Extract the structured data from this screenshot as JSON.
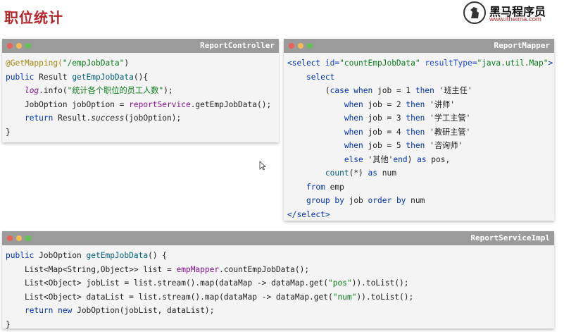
{
  "slide": {
    "title": "职位统计"
  },
  "brand": {
    "name": "黑马程序员",
    "url": "www.itheima.com"
  },
  "controller": {
    "title": "ReportController",
    "lines": [
      [
        "@GetMapping(",
        "\"/empJobData\"",
        ")"
      ],
      [
        "public",
        " Result ",
        "getEmpJobData",
        "(){"
      ],
      [
        "    ",
        "log",
        ".info(",
        "\"统计各个职位的员工人数\"",
        ");"
      ],
      [
        "    JobOption jobOption = ",
        "reportService",
        ".getEmpJobData();"
      ],
      [
        "    ",
        "return",
        " Result.",
        "success",
        "(jobOption);"
      ],
      [
        "}"
      ]
    ]
  },
  "mapper": {
    "title": "ReportMapper",
    "lines": [
      [
        "<select ",
        "id=",
        "\"countEmpJobData\"",
        " resultType=",
        "\"java.util.Map\"",
        ">"
      ],
      [
        "    ",
        "select"
      ],
      [
        "        (",
        "case when",
        " job = 1 ",
        "then",
        " '班主任'"
      ],
      [
        "            ",
        "when",
        " job = 2 ",
        "then",
        " '讲师'"
      ],
      [
        "            ",
        "when",
        " job = 3 ",
        "then",
        " '学工主管'"
      ],
      [
        "            ",
        "when",
        " job = 4 ",
        "then",
        " '教研主管'"
      ],
      [
        "            ",
        "when",
        " job = 5 ",
        "then",
        " '咨询师'"
      ],
      [
        "            ",
        "else",
        " '其他'",
        "end",
        ") ",
        "as",
        " pos,"
      ],
      [
        "        ",
        "count",
        "(*) ",
        "as",
        " num"
      ],
      [
        "    ",
        "from",
        " emp"
      ],
      [
        "    ",
        "group by",
        " job ",
        "order by",
        " num"
      ],
      [
        "</select>"
      ]
    ]
  },
  "service": {
    "title": "ReportServiceImpl",
    "lines": [
      [
        "public",
        " JobOption ",
        "getEmpJobData",
        "() {"
      ],
      [
        "    List<Map<String,Object>> list = ",
        "empMapper",
        ".countEmpJobData();"
      ],
      [
        "    List<Object> jobList = list.stream().map(dataMap -> dataMap.get(",
        "\"pos\"",
        ")).toList();"
      ],
      [
        "    List<Object> dataList = list.stream().map(dataMap -> dataMap.get(",
        "\"num\"",
        ")).toList();"
      ],
      [
        "    ",
        "return",
        " ",
        "new",
        " JobOption(jobList, dataList);"
      ],
      [
        "}"
      ]
    ]
  },
  "colors": {
    "title": "#b3262b",
    "keyword": "#0033b3",
    "string": "#067d17",
    "annotation": "#9e880d",
    "field": "#871094"
  }
}
